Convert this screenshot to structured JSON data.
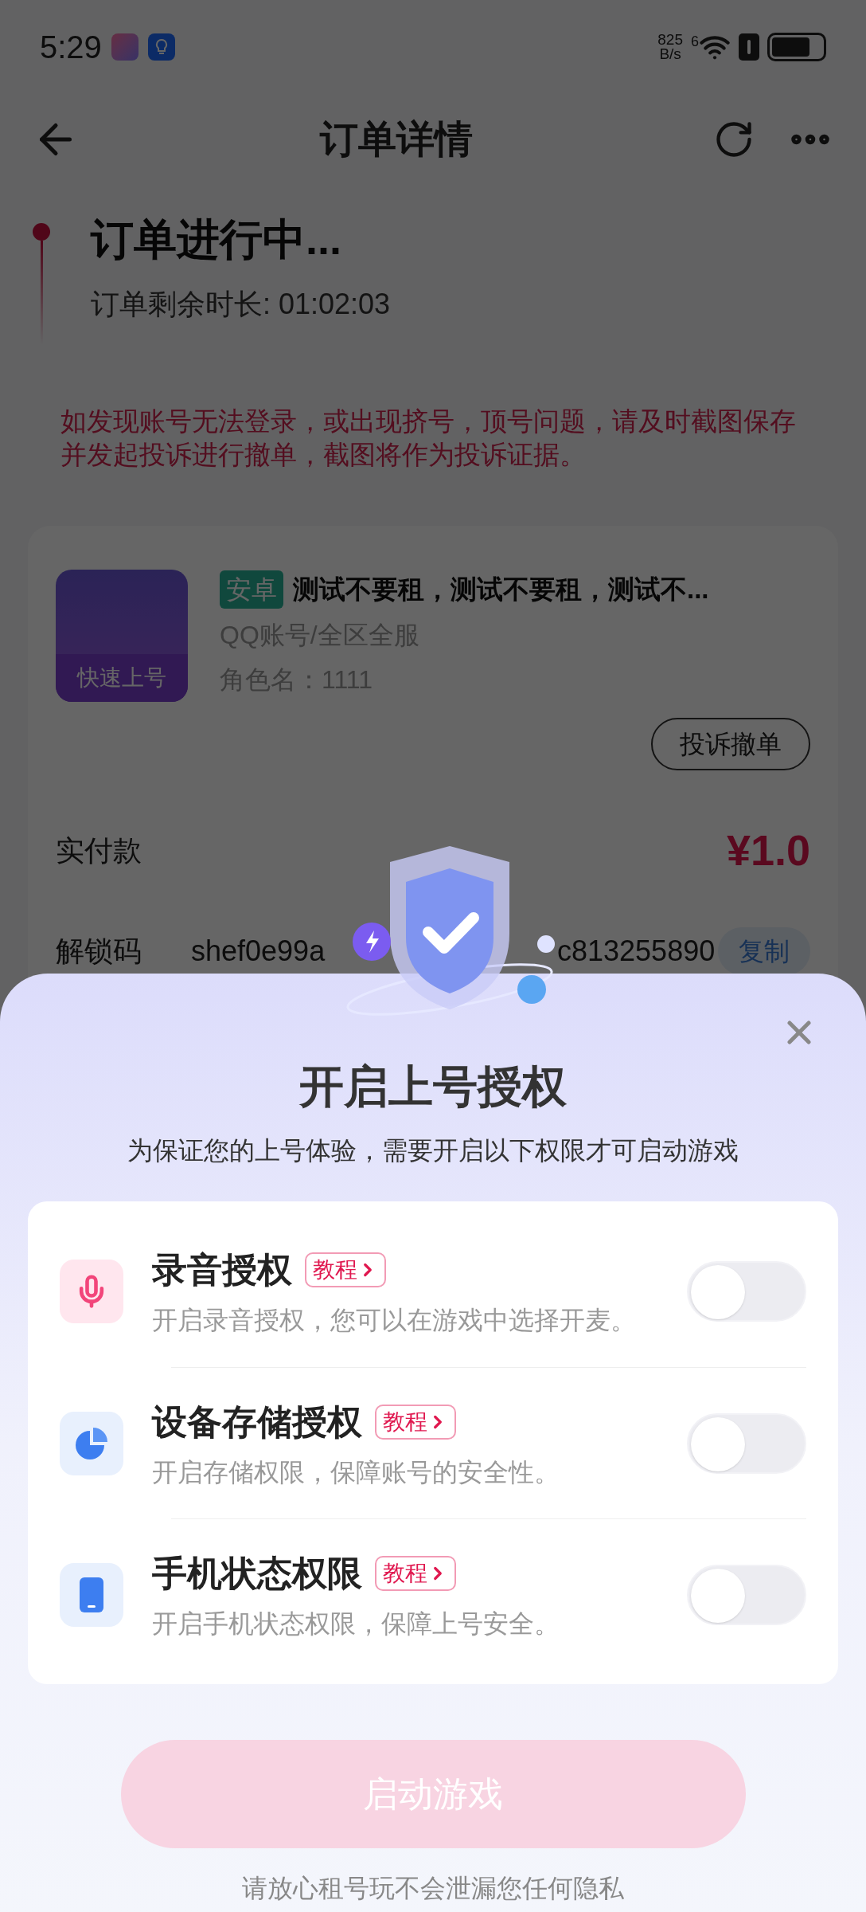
{
  "status_bar": {
    "time": "5:29",
    "net_speed_value": "825",
    "net_speed_unit": "B/s",
    "signal_label": "6"
  },
  "header": {
    "title": "订单详情"
  },
  "order_status": {
    "title": "订单进行中...",
    "remaining": "订单剩余时长: 01:02:03"
  },
  "notice": "如发现账号无法登录，或出现挤号，顶号问题，请及时截图保存并发起投诉进行撤单，截图将作为投诉证据。",
  "listing": {
    "thumbnail_label": "快速上号",
    "platform_tag": "安卓",
    "title": "测试不要租，测试不要租，测试不...",
    "account_type": "QQ账号/全区全服",
    "role": "角色名：1111",
    "complain_button": "投诉撤单"
  },
  "payment": {
    "label": "实付款",
    "amount": "¥1.0"
  },
  "unlock_code": {
    "label": "解锁码",
    "value_start": "shef0e99a",
    "value_end": "c813255890",
    "copy_button": "复制"
  },
  "dialog": {
    "title": "开启上号授权",
    "subtitle": "为保证您的上号体验，需要开启以下权限才可启动游戏",
    "permissions": [
      {
        "kind": "microphone",
        "name": "录音授权",
        "tutorial": "教程",
        "description": "开启录音授权，您可以在游戏中选择开麦。",
        "on": false
      },
      {
        "kind": "storage",
        "name": "设备存储授权",
        "tutorial": "教程",
        "description": "开启存储权限，保障账号的安全性。",
        "on": false
      },
      {
        "kind": "phone",
        "name": "手机状态权限",
        "tutorial": "教程",
        "description": "开启手机状态权限，保障上号安全。",
        "on": false
      }
    ],
    "start_button": "启动游戏",
    "start_disabled": true,
    "footer": "请放心租号玩不会泄漏您任何隐私"
  }
}
